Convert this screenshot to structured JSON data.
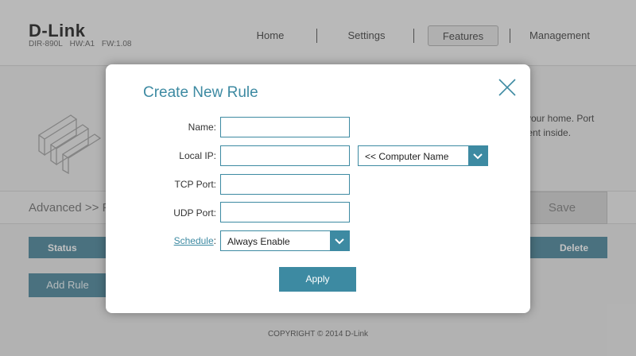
{
  "header": {
    "brand": "D-Link",
    "model": "DIR-890L",
    "hw": "HW:A1",
    "fw": "FW:1.08",
    "nav": [
      "Home",
      "Settings",
      "Features",
      "Management"
    ]
  },
  "hero": {
    "desc_line1": "n your home. Port",
    "desc_line2": "client inside."
  },
  "breadcrumb": "Advanced >> F",
  "save_label": "Save",
  "table": {
    "col_status": "Status",
    "col_delete": "Delete"
  },
  "add_rule_label": "Add Rule",
  "copyright": "COPYRIGHT © 2014 D-Link",
  "modal": {
    "title": "Create New Rule",
    "name_label": "Name:",
    "name_value": "",
    "local_ip_label": "Local IP:",
    "local_ip_value": "",
    "computer_select": "<< Computer Name",
    "tcp_label": "TCP Port:",
    "tcp_value": "",
    "udp_label": "UDP Port:",
    "udp_value": "",
    "schedule_link": "Schedule",
    "schedule_colon": ":",
    "schedule_value": "Always Enable",
    "apply_label": "Apply"
  },
  "icons": {
    "close": "close-icon",
    "dropdown": "chevron-down-icon"
  },
  "colors": {
    "accent": "#3d8aa2",
    "table_header": "#3e7d93"
  }
}
